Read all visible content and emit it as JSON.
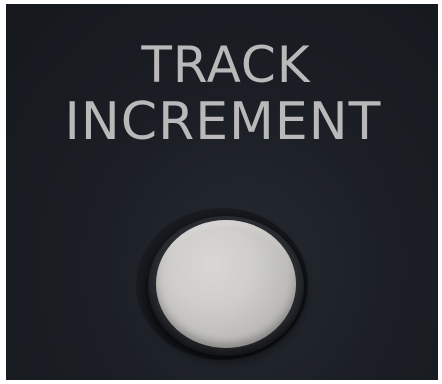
{
  "panel": {
    "label_line_1": "TRACK",
    "label_line_2": "INCREMENT"
  },
  "colors": {
    "panel_background": "#1b1f25",
    "label_text": "#b9b9ba",
    "button_cap": "#cfcecb"
  }
}
